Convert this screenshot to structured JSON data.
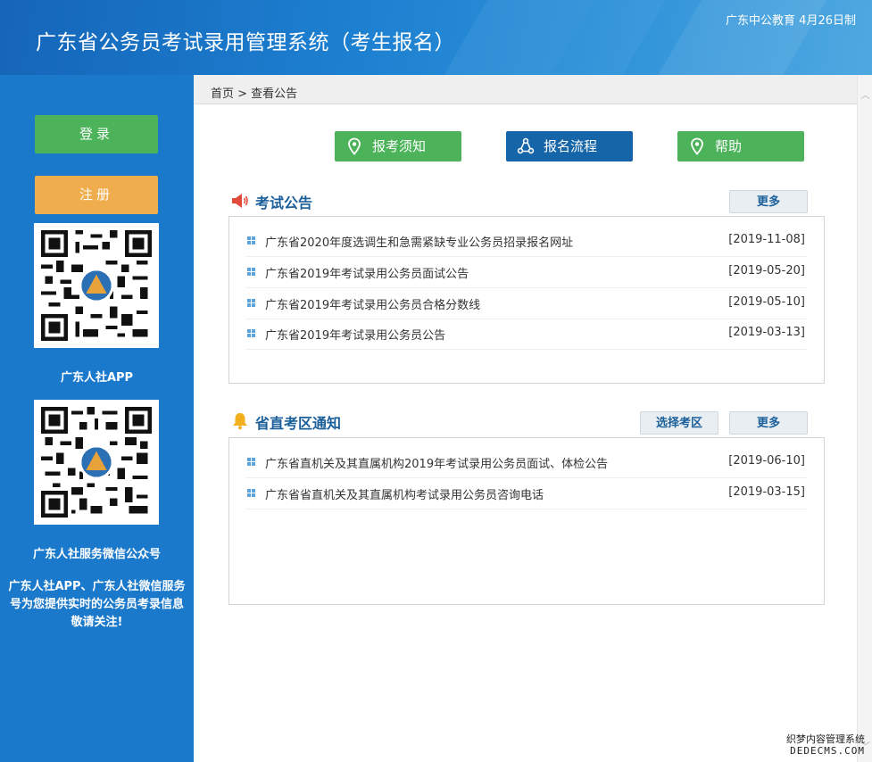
{
  "header": {
    "title": "广东省公务员考试录用管理系统（考生报名）",
    "note": "广东中公教育 4月26日制"
  },
  "sidebar": {
    "login_label": "登录",
    "register_label": "注册",
    "qr1_label": "广东人社APP",
    "qr2_label": "广东人社服务微信公众号",
    "note": "广东人社APP、广东人社微信服务号为您提供实时的公务员考录信息 敬请关注!"
  },
  "breadcrumb": {
    "text": "首页 > 查看公告"
  },
  "quick_buttons": [
    {
      "label": "报考须知",
      "icon": "location-pin-icon",
      "color": "#4cb35a"
    },
    {
      "label": "报名流程",
      "icon": "flow-cycle-icon",
      "color": "#1565a8"
    },
    {
      "label": "帮助",
      "icon": "location-pin-icon",
      "color": "#4cb35a"
    }
  ],
  "exam_notices": {
    "title": "考试公告",
    "more_label": "更多",
    "items": [
      {
        "title": "广东省2020年度选调生和急需紧缺专业公务员招录报名网址",
        "date": "[2019-11-08]"
      },
      {
        "title": "广东省2019年考试录用公务员面试公告",
        "date": "[2019-05-20]"
      },
      {
        "title": "广东省2019年考试录用公务员合格分数线",
        "date": "[2019-05-10]"
      },
      {
        "title": "广东省2019年考试录用公务员公告",
        "date": "[2019-03-13]"
      }
    ]
  },
  "district_notices": {
    "title": "省直考区通知",
    "choose_label": "选择考区",
    "more_label": "更多",
    "items": [
      {
        "title": "广东省直机关及其直属机构2019年考试录用公务员面试、体检公告",
        "date": "[2019-06-10]"
      },
      {
        "title": "广东省省直机关及其直属机构考试录用公务员咨询电话",
        "date": "[2019-03-15]"
      }
    ]
  },
  "watermark": {
    "line1": "织梦内容管理系统",
    "line2": "DEDECMS.COM"
  },
  "colors": {
    "header_blue": "#1d7fd0",
    "sidebar_blue": "#1b79cc",
    "green": "#4cb35a",
    "orange": "#f0ad4e",
    "dark_blue": "#1565a8",
    "section_title": "#1a5e9a"
  }
}
